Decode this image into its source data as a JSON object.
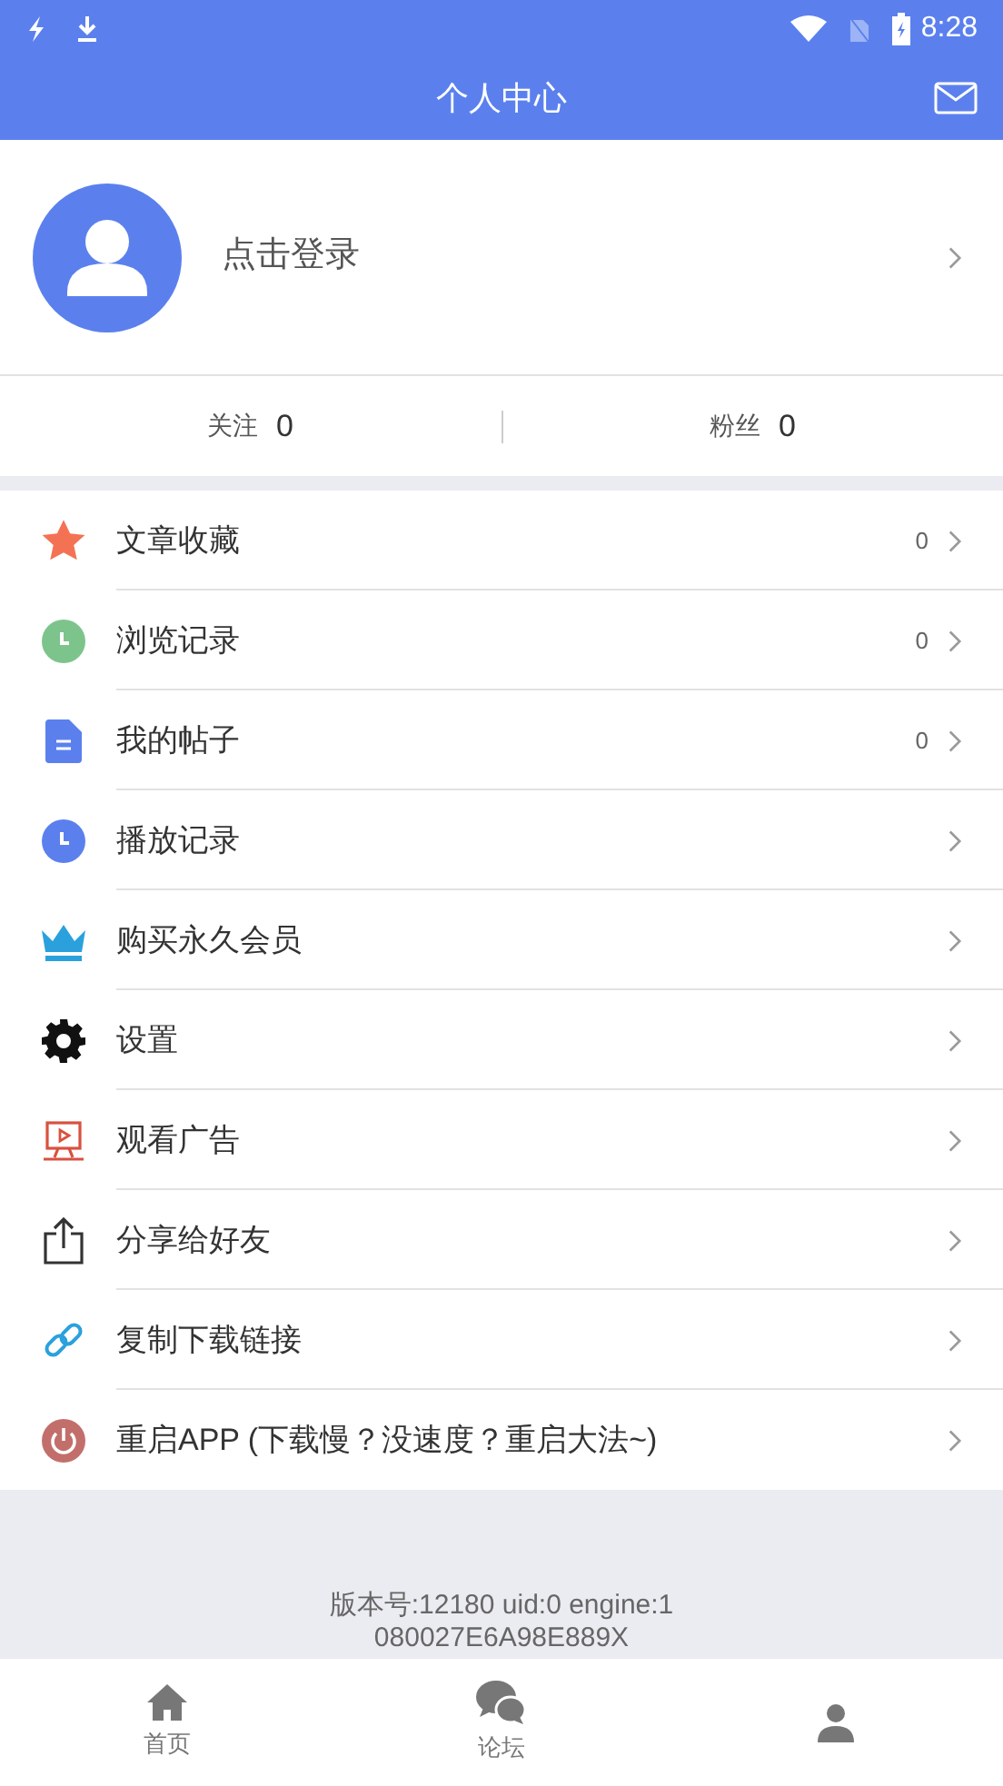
{
  "status_bar": {
    "time": "8:28"
  },
  "header": {
    "title": "个人中心"
  },
  "profile": {
    "login_label": "点击登录"
  },
  "stats": [
    {
      "label": "关注",
      "value": "0"
    },
    {
      "label": "粉丝",
      "value": "0"
    }
  ],
  "menu": [
    {
      "kind": "star",
      "label": "文章收藏",
      "count": "0"
    },
    {
      "kind": "clock-green",
      "label": "浏览记录",
      "count": "0"
    },
    {
      "kind": "document",
      "label": "我的帖子",
      "count": "0"
    },
    {
      "kind": "clock-blue",
      "label": "播放记录"
    },
    {
      "kind": "crown",
      "label": "购买永久会员"
    },
    {
      "kind": "gear",
      "label": "设置"
    },
    {
      "kind": "monitor",
      "label": "观看广告"
    },
    {
      "kind": "share",
      "label": "分享给好友"
    },
    {
      "kind": "link",
      "label": "复制下载链接"
    },
    {
      "kind": "power",
      "label": "重启APP (下载慢？没速度？重启大法~)"
    }
  ],
  "version_lines": [
    "版本号:12180 uid:0 engine:1",
    "080027E6A98E889X"
  ],
  "bottom_nav": [
    {
      "kind": "home",
      "label": "首页"
    },
    {
      "kind": "chat",
      "label": "论坛"
    },
    {
      "kind": "person"
    }
  ]
}
